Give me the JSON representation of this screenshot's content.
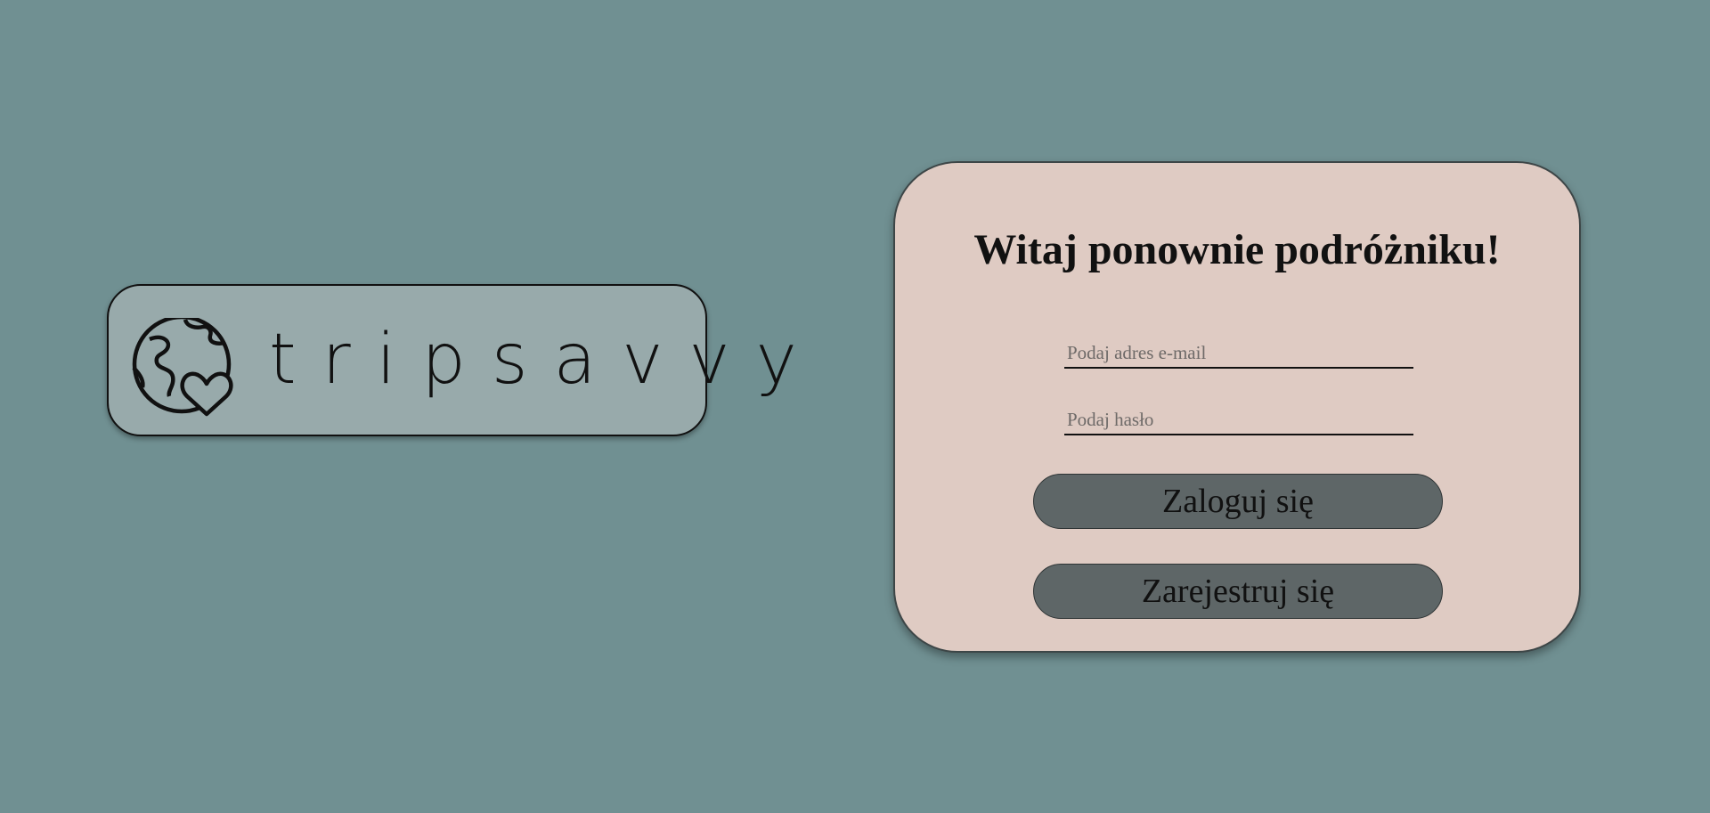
{
  "logo": {
    "icon": "globe-heart-icon",
    "text": "tripsavvy"
  },
  "login": {
    "title": "Witaj ponownie podróżniku!",
    "email_placeholder": "Podaj adres e-mail",
    "password_placeholder": "Podaj hasło",
    "login_label": "Zaloguj się",
    "register_label": "Zarejestruj się"
  },
  "colors": {
    "background": "#709092",
    "logo_box": "#98aaab",
    "card": "#dfcbc3",
    "button": "#5e6667"
  }
}
